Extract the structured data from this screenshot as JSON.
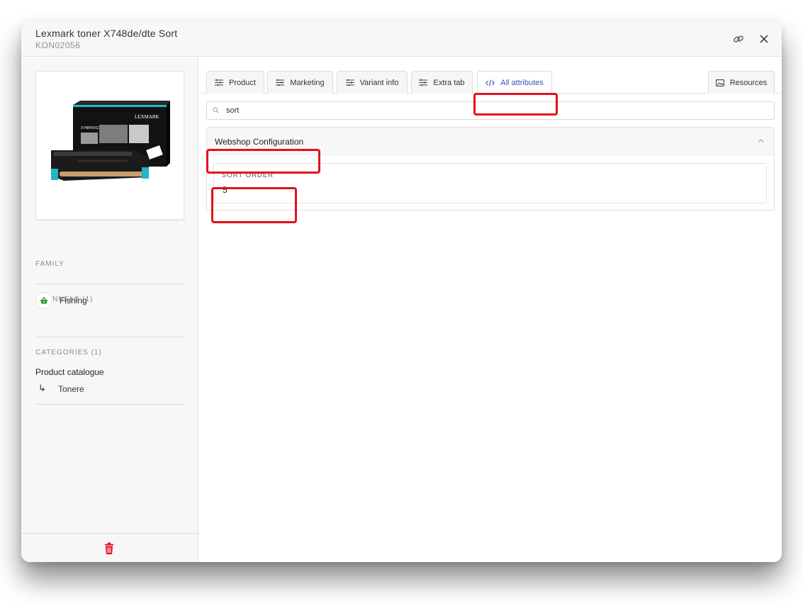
{
  "header": {
    "title": "Lexmark toner X748de/dte Sort",
    "subtitle": "KON02056",
    "link_icon": "link-icon",
    "close_icon": "close-icon"
  },
  "sidebar": {
    "image_alt": "LEXMARK",
    "image_box_label": "X748H1KG",
    "family_label": "FAMILY",
    "channels_label": "CHANNELS (1)",
    "channels": [
      {
        "name": "Fishing",
        "icon": "basket-icon",
        "color": "#1f9d2b"
      }
    ],
    "categories_label": "CATEGORIES (1)",
    "category_root": "Product catalogue",
    "category_arrow": "↳",
    "category_child": "Tonere",
    "delete_icon": "trash-icon",
    "delete_color": "#e3101c"
  },
  "tabs": [
    {
      "label": "Product",
      "icon": "sliders-icon"
    },
    {
      "label": "Marketing",
      "icon": "sliders-icon"
    },
    {
      "label": "Variant info",
      "icon": "sliders-icon"
    },
    {
      "label": "Extra tab",
      "icon": "sliders-icon"
    },
    {
      "label": "All attributes",
      "icon": "code-icon",
      "active": true
    },
    {
      "label": "Resources",
      "icon": "image-icon"
    }
  ],
  "search": {
    "value": "sort",
    "icon": "search-icon"
  },
  "group": {
    "title": "Webshop Configuration",
    "expanded": true,
    "fields": [
      {
        "label": "SORT ORDER",
        "value": "5"
      }
    ]
  },
  "colors": {
    "accent": "#3a55b0",
    "highlight": "#e3101c"
  }
}
